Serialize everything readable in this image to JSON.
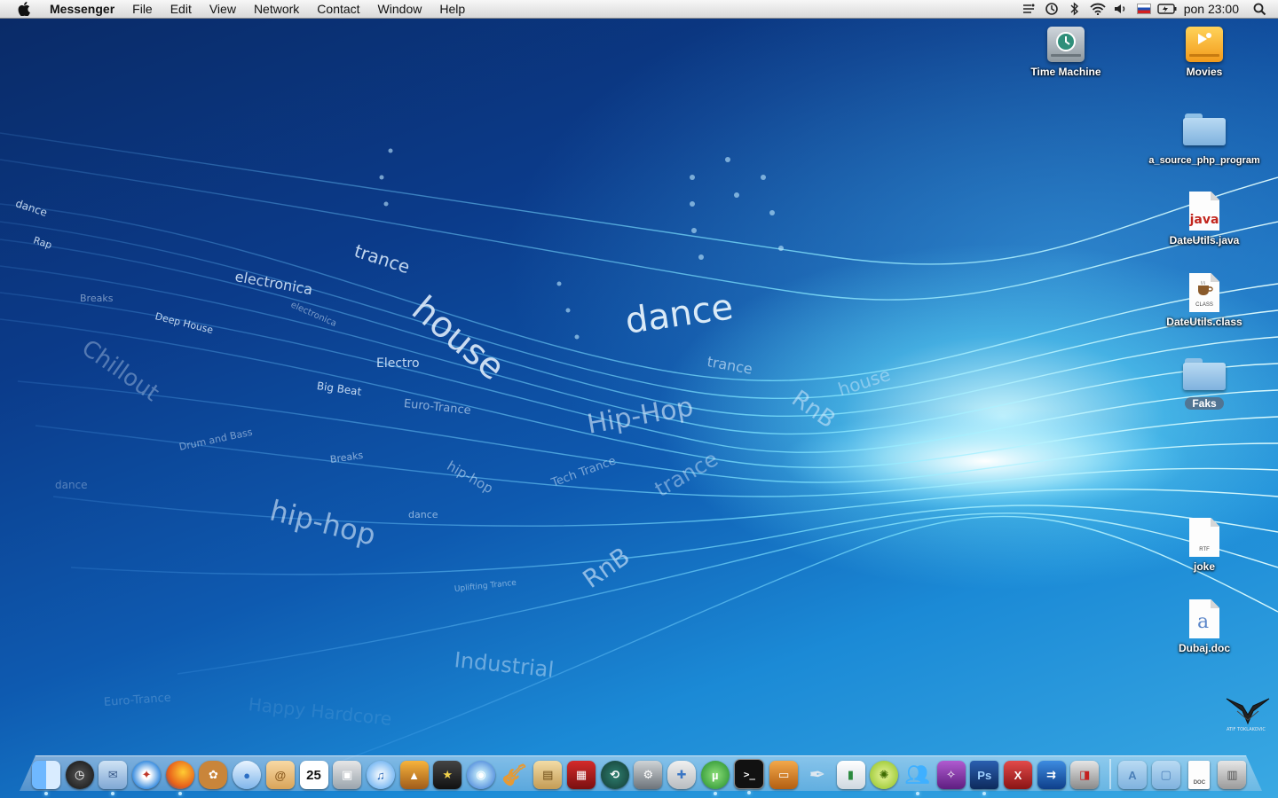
{
  "menubar": {
    "app_name": "Messenger",
    "menus": [
      "File",
      "Edit",
      "View",
      "Network",
      "Contact",
      "Window",
      "Help"
    ],
    "clock": "pon 23:00"
  },
  "desktop_icons": [
    {
      "label": "Time Machine",
      "icon": "time-machine-drive-icon"
    },
    {
      "label": "Movies",
      "icon": "movies-drive-icon"
    },
    {
      "label": "a_source_php_program",
      "icon": "folder-icon"
    },
    {
      "label": "DateUtils.java",
      "icon": "java-file-icon"
    },
    {
      "label": "DateUtils.class",
      "icon": "class-file-icon"
    },
    {
      "label": "Faks",
      "icon": "folder-icon"
    },
    {
      "label": "joke",
      "icon": "rtf-file-icon"
    },
    {
      "label": "Dubaj.doc",
      "icon": "doc-file-icon"
    }
  ],
  "wallpaper_words": [
    "dance",
    "Rap",
    "trance",
    "electronica",
    "house",
    "Breaks",
    "Deep House",
    "Chillout",
    "Electro",
    "Big Beat",
    "Euro-Trance",
    "dance",
    "Hip-Hop",
    "trance",
    "RnB",
    "house",
    "Drum and Bass",
    "hip-hop",
    "Tech Trance",
    "trance",
    "dance",
    "Breaks",
    "RnB",
    "Uplifting Trance",
    "Industrial",
    "Euro-Trance",
    "Happy Hardcore",
    "electronica",
    "hip-hop",
    "dance"
  ],
  "dock": {
    "apps": [
      "Finder",
      "Dashboard",
      "Mail",
      "Safari",
      "Firefox",
      "Adium",
      "iChat",
      "Address Book",
      "iCal",
      "Preview",
      "iTunes",
      "iPhoto",
      "iMovie",
      "DVD Player",
      "GarageBand",
      "iWeb",
      "Photo Booth",
      "Time Machine",
      "System Preferences",
      "Disk Utility",
      "uTorrent",
      "Terminal",
      "Keynote",
      "Script Editor",
      "Numbers",
      "Cisco",
      "Messenger",
      "Dreamweaver",
      "Photoshop",
      "CrossOver",
      "Parallels",
      "VMware Fusion"
    ],
    "stacks": [
      "Applications",
      "Documents",
      "Downloads",
      "Trash"
    ],
    "doc_label": "DOC",
    "rtf_label": "RTF",
    "class_label": "CLASS",
    "java_label": "java"
  },
  "logo_text": "ATIF TOKLAKOVIC",
  "colors": {
    "menubar": "#e6e6e6",
    "wallpaper_dark": "#0a2a66",
    "wallpaper_light": "#3aa9e3",
    "glow": "#d2faff"
  }
}
